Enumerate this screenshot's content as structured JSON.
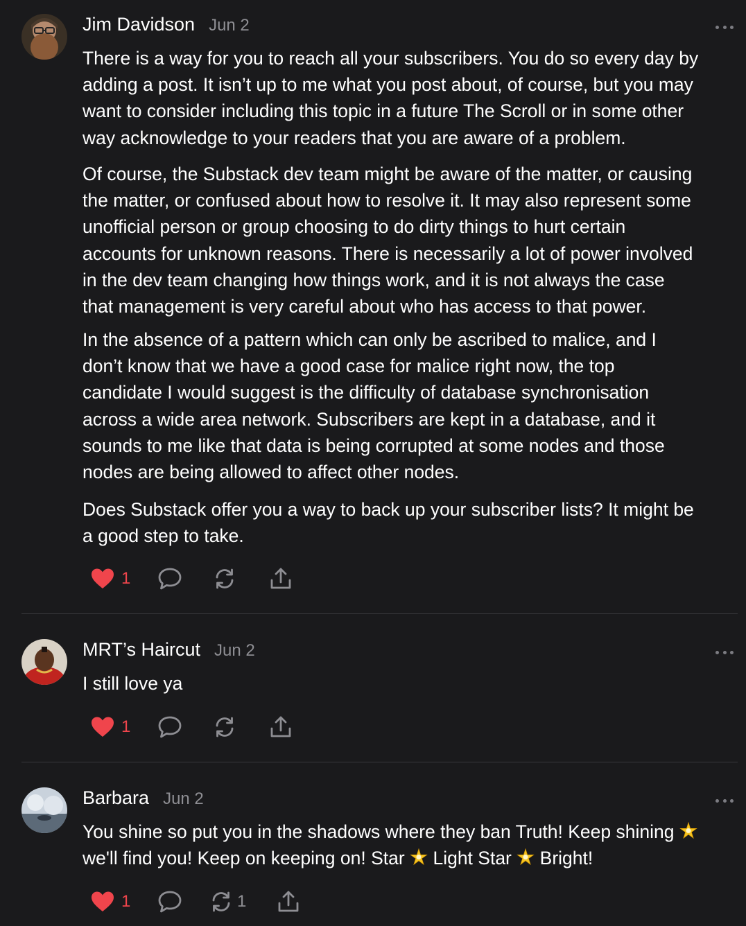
{
  "comments": [
    {
      "author": "Jim Davidson",
      "date": "Jun 2",
      "avatar": "avatar-bearded-man",
      "paragraphs": [
        [
          "There is a way for you to reach all your subscribers. You do so every day by",
          "adding a post. It isn’t up to me what you post about, of course, but you may",
          "want to consider including this topic in a future The Scroll or in some other",
          "way acknowledge to your readers that you are aware of a problem."
        ],
        [
          "Of course, the Substack dev team might be aware of the matter, or causing",
          "the matter, or confused about how to resolve it. It may also represent some",
          "unofficial person or group choosing to do dirty things to hurt certain",
          "accounts for unknown reasons. There is necessarily a lot of power involved",
          "in the dev team changing how things work, and it is not always the case",
          "that management is very careful about who has access to that power."
        ],
        [
          "In the absence of a pattern which can only be ascribed to malice, and I",
          "don’t know that we have a good case for malice right now, the top",
          "candidate I would suggest is the difficulty of database synchronisation",
          "across a wide area network. Subscribers are kept in a database, and it",
          "sounds to me like that data is being corrupted at some nodes and those",
          "nodes are being allowed to affect other nodes."
        ],
        [
          "Does Substack offer you a way to back up your subscriber lists? It might be",
          "a good step to take."
        ]
      ],
      "like_count": "1",
      "restack_count": ""
    },
    {
      "author": "MRT’s Haircut",
      "date": "Jun 2",
      "avatar": "avatar-man-red-shirt",
      "paragraphs": [
        [
          "I still love ya"
        ]
      ],
      "like_count": "1",
      "restack_count": ""
    },
    {
      "author": "Barbara",
      "date": "Jun 2",
      "avatar": "avatar-winter-landscape",
      "line1_text": "You shine so put you in the shadows where they ban Truth! Keep shining",
      "line2_parts": [
        "we'll find you! Keep on keeping on! Star",
        "Light Star",
        "Bright!"
      ],
      "emoji": "glowing-star-emoji",
      "like_count": "1",
      "restack_count": "1"
    }
  ],
  "icons": {
    "like": "heart-icon",
    "reply": "speech-bubble-icon",
    "restack": "restack-icon",
    "share": "share-icon",
    "more": "ellipsis-icon"
  },
  "colors": {
    "background": "#1a1a1c",
    "text": "#ffffff",
    "muted": "#8e8e93",
    "like": "#f0454c",
    "divider": "#38383c"
  }
}
